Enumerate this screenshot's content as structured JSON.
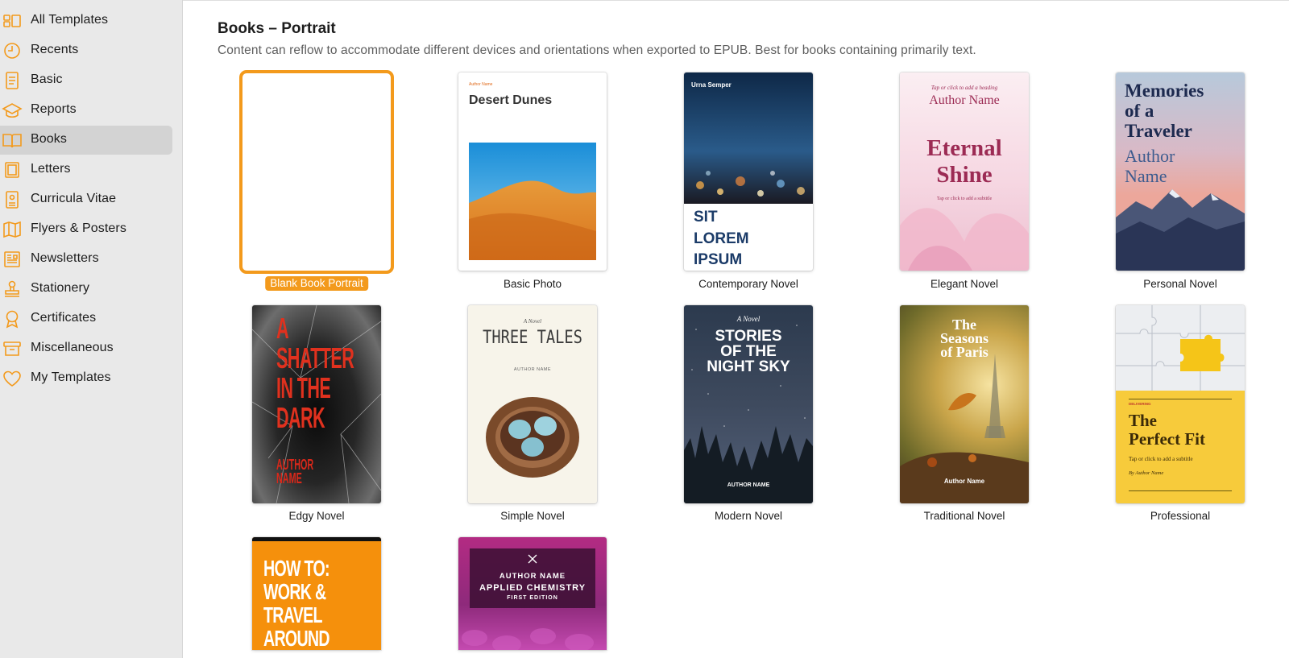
{
  "sidebar": {
    "items": [
      {
        "label": "All Templates",
        "icon": "all-templates-icon"
      },
      {
        "label": "Recents",
        "icon": "clock-icon"
      },
      {
        "label": "Basic",
        "icon": "document-icon"
      },
      {
        "label": "Reports",
        "icon": "report-icon"
      },
      {
        "label": "Books",
        "icon": "book-icon",
        "selected": true
      },
      {
        "label": "Letters",
        "icon": "letter-icon"
      },
      {
        "label": "Curricula Vitae",
        "icon": "cv-icon"
      },
      {
        "label": "Flyers & Posters",
        "icon": "map-icon"
      },
      {
        "label": "Newsletters",
        "icon": "newsletter-icon"
      },
      {
        "label": "Stationery",
        "icon": "stamp-icon"
      },
      {
        "label": "Certificates",
        "icon": "ribbon-icon"
      },
      {
        "label": "Miscellaneous",
        "icon": "box-icon"
      },
      {
        "label": "My Templates",
        "icon": "heart-icon"
      }
    ]
  },
  "main": {
    "title": "Books – Portrait",
    "description": "Content can reflow to accommodate different devices and orientations when exported to EPUB. Best for books containing primarily text."
  },
  "templates": [
    {
      "name": "Blank Book Portrait",
      "selected": true
    },
    {
      "name": "Basic Photo",
      "cover": {
        "author": "Author Name",
        "title": "Desert Dunes"
      }
    },
    {
      "name": "Contemporary Novel",
      "cover": {
        "author": "Urna Semper",
        "title": "SIT\nLOREM\nIPSUM"
      }
    },
    {
      "name": "Elegant Novel",
      "cover": {
        "heading": "Tap or click to add a heading",
        "author": "Author Name",
        "title": "Eternal\nShine",
        "subtitle": "Tap or click to add a subtitle"
      }
    },
    {
      "name": "Personal Novel",
      "cover": {
        "title": "Memories\nof a\nTraveler",
        "author": "Author\nName"
      }
    },
    {
      "name": "Edgy Novel",
      "cover": {
        "title": "A\nSHATTER\nIN THE\nDARK",
        "author": "AUTHOR\nNAME"
      }
    },
    {
      "name": "Simple Novel",
      "cover": {
        "kicker": "A Novel",
        "title": "THREE TALES",
        "author": "AUTHOR NAME"
      }
    },
    {
      "name": "Modern Novel",
      "cover": {
        "kicker": "A Novel",
        "title": "STORIES\nOF THE\nNIGHT SKY",
        "author": "AUTHOR NAME"
      }
    },
    {
      "name": "Traditional Novel",
      "cover": {
        "title": "The\nSeasons\nof Paris",
        "author": "Author Name"
      }
    },
    {
      "name": "Professional",
      "cover": {
        "kicker": "DELIVERING",
        "title": "The\nPerfect Fit",
        "subtitle": "Tap or click to add a subtitle",
        "author": "By Author Name"
      }
    },
    {
      "name": "",
      "cover": {
        "title": "HOW TO:\nWORK &\nTRAVEL\nAROUND"
      }
    },
    {
      "name": "",
      "cover": {
        "author": "AUTHOR NAME",
        "title": "APPLIED CHEMISTRY",
        "edition": "FIRST EDITION"
      }
    }
  ],
  "colors": {
    "accent": "#f39a1c",
    "sidebar_bg": "#e9e9e9",
    "sidebar_selected": "#d3d3d3"
  }
}
